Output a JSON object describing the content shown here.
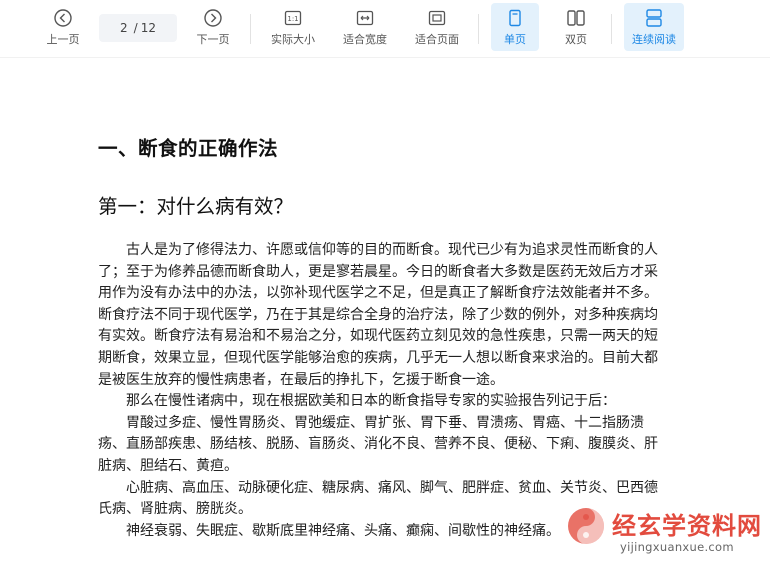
{
  "toolbar": {
    "prev_label": "上一页",
    "current_page": "2",
    "total_pages": "12",
    "page_separator": "/",
    "next_label": "下一页",
    "actual_size_label": "实际大小",
    "fit_width_label": "适合宽度",
    "fit_page_label": "适合页面",
    "single_page_label": "单页",
    "double_page_label": "双页",
    "continuous_label": "连续阅读",
    "active_color": "#1e88e5",
    "active_bg": "#e3f1fc"
  },
  "document": {
    "heading": "一、断食的正确作法",
    "subheading": "第一：对什么病有效？",
    "paragraphs": [
      "古人是为了修得法力、许愿或信仰等的目的而断食。现代已少有为追求灵性而断食的人了；至于为修养品德而断食助人，更是寥若晨星。今日的断食者大多数是医药无效后方才采用作为没有办法中的办法，以弥补现代医学之不足，但是真正了解断食疗法效能者并不多。断食疗法不同于现代医学，乃在于其是综合全身的治疗法，除了少数的例外，对多种疾病均有实效。断食疗法有易治和不易治之分，如现代医药立刻见效的急性疾患，只需一两天的短期断食，效果立显，但现代医学能够治愈的疾病，几乎无一人想以断食来求治的。目前大都是被医生放弃的慢性病患者，在最后的挣扎下，乞援于断食一途。",
      "那么在慢性诸病中，现在根据欧美和日本的断食指导专家的实验报告列记于后：",
      "胃酸过多症、慢性胃肠炎、胃弛缓症、胃扩张、胃下垂、胃溃疡、胃癌、十二指肠溃疡、直肠部疾患、肠结核、脱肠、盲肠炎、消化不良、营养不良、便秘、下痢、腹膜炎、肝脏病、胆结石、黄疸。",
      "心脏病、高血压、动脉硬化症、糖尿病、痛风、脚气、肥胖症、贫血、关节炎、巴西德氏病、肾脏病、膀胱炎。",
      "神经衰弱、失眠症、歇斯底里神经痛、头痛、癫痫、间歇性的神经痛。"
    ]
  },
  "watermark": {
    "brand": "经玄学资料网",
    "url": "yijingxuanxue.com",
    "brand_color": "#e03c2e"
  }
}
